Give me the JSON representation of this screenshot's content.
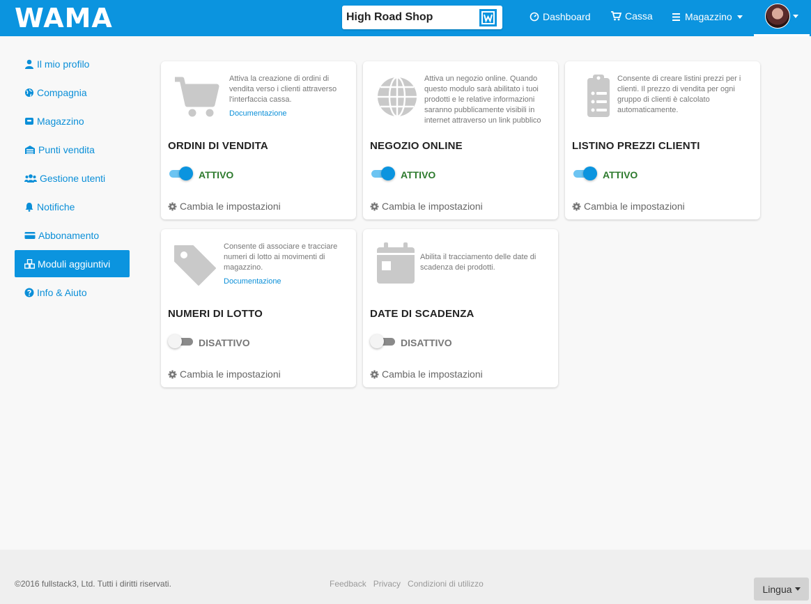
{
  "header": {
    "logo_text": "WAMA",
    "shop_name": "High Road Shop",
    "shop_badge": "W",
    "nav": {
      "dashboard": "Dashboard",
      "cassa": "Cassa",
      "magazzino": "Magazzino"
    }
  },
  "sidebar": {
    "items": [
      {
        "label": "Il mio profilo",
        "icon": "user-icon"
      },
      {
        "label": "Compagnia",
        "icon": "globe-icon"
      },
      {
        "label": "Magazzino",
        "icon": "box-icon"
      },
      {
        "label": "Punti vendita",
        "icon": "store-icon"
      },
      {
        "label": "Gestione utenti",
        "icon": "users-icon"
      },
      {
        "label": "Notifiche",
        "icon": "bell-icon"
      },
      {
        "label": "Abbonamento",
        "icon": "credit-card-icon"
      },
      {
        "label": "Moduli aggiuntivi",
        "icon": "cubes-icon",
        "active": true
      },
      {
        "label": "Info & Aiuto",
        "icon": "question-icon"
      }
    ]
  },
  "modules": [
    {
      "title": "ORDINI DI VENDITA",
      "icon": "cart-icon",
      "description": "Attiva la creazione di ordini di vendita verso i clienti attraverso l'interfaccia cassa.",
      "doc_link": "Documentazione",
      "status": "ATTIVO",
      "enabled": true,
      "settings_label": "Cambia le impostazioni"
    },
    {
      "title": "NEGOZIO ONLINE",
      "icon": "globe-icon",
      "description": "Attiva un negozio online. Quando questo modulo sarà abilitato i tuoi prodotti e le relative informazioni saranno pubblicamente visibili in internet attraverso un link pubblico",
      "status": "ATTIVO",
      "enabled": true,
      "settings_label": "Cambia le impostazioni"
    },
    {
      "title": "LISTINO PREZZI CLIENTI",
      "icon": "clipboard-list-icon",
      "description": "Consente di creare listini prezzi per i clienti. Il prezzo di vendita per ogni gruppo di clienti è calcolato automaticamente.",
      "status": "ATTIVO",
      "enabled": true,
      "settings_label": "Cambia le impostazioni"
    },
    {
      "title": "NUMERI DI LOTTO",
      "icon": "tag-icon",
      "description": "Consente di associare e tracciare numeri di lotto ai movimenti di magazzino.",
      "doc_link": "Documentazione",
      "status": "DISATTIVO",
      "enabled": false,
      "settings_label": "Cambia le impostazioni"
    },
    {
      "title": "DATE DI SCADENZA",
      "icon": "calendar-icon",
      "description": "Abilita il tracciamento delle date di scadenza dei prodotti.",
      "status": "DISATTIVO",
      "enabled": false,
      "settings_label": "Cambia le impostazioni"
    }
  ],
  "footer": {
    "copyright": "©2016 fullstack3, Ltd. Tutti i diritti riservati.",
    "links": [
      "Feedback",
      "Privacy",
      "Condizioni di utilizzo"
    ],
    "language_button": "Lingua"
  },
  "colors": {
    "primary": "#0b94df",
    "active_status": "#2d7a2d",
    "inactive_status": "#777777"
  }
}
